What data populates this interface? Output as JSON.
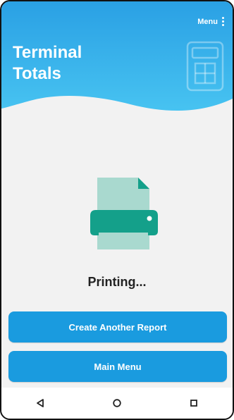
{
  "header": {
    "menu_label": "Menu",
    "title_line1": "Terminal",
    "title_line2": "Totals"
  },
  "content": {
    "status_text": "Printing..."
  },
  "buttons": {
    "create_another_report": "Create Another Report",
    "main_menu": "Main Menu"
  },
  "navbar": {
    "items": [
      "back-icon",
      "home-icon",
      "recents-icon"
    ]
  },
  "colors": {
    "header_gradient_top": "#2aa0e4",
    "header_gradient_bottom": "#47c3f1",
    "button_bg": "#1a9bdf",
    "printer_teal": "#14a08a",
    "document_light": "#a9d9cf"
  }
}
